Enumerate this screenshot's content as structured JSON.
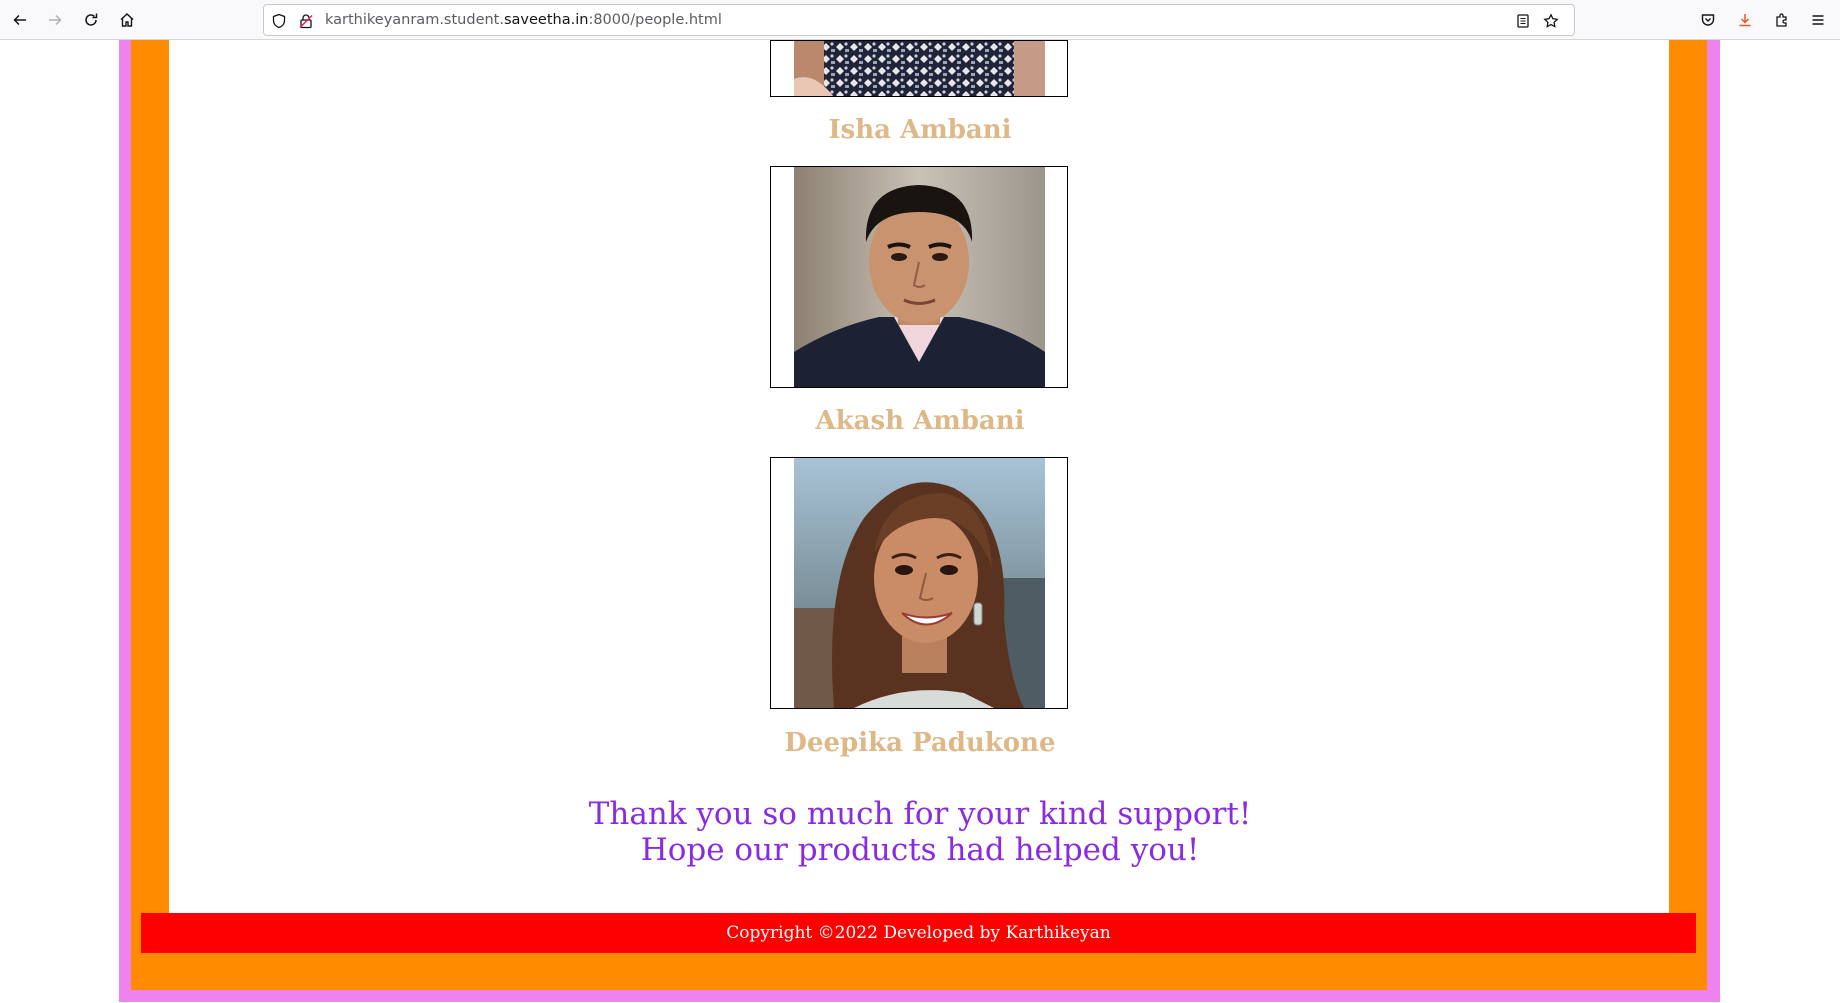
{
  "browser": {
    "url_prefix": "karthikeyanram.student.",
    "url_domain": "saveetha.in",
    "url_suffix": ":8000/people.html",
    "icons": [
      "back-arrow-icon",
      "forward-arrow-icon",
      "reload-icon",
      "home-icon",
      "shield-icon",
      "insecure-lock-icon",
      "reader-view-icon",
      "bookmark-star-icon",
      "pocket-icon",
      "download-icon",
      "extensions-icon",
      "menu-icon"
    ]
  },
  "people": [
    {
      "name": "Isha Ambani"
    },
    {
      "name": "Akash Ambani"
    },
    {
      "name": "Deepika Padukone"
    }
  ],
  "thanks": {
    "line1": "Thank you so much for your kind support!",
    "line2": "Hope our products had helped you!"
  },
  "footer": {
    "text": "Copyright ©2022 Developed by Karthikeyan"
  },
  "colors": {
    "outer_border": "#ee82ee",
    "inner_border": "#ff8c00",
    "name_text": "#deb887",
    "thanks_text": "#8a2be2",
    "footer_bg": "#ff0000"
  }
}
